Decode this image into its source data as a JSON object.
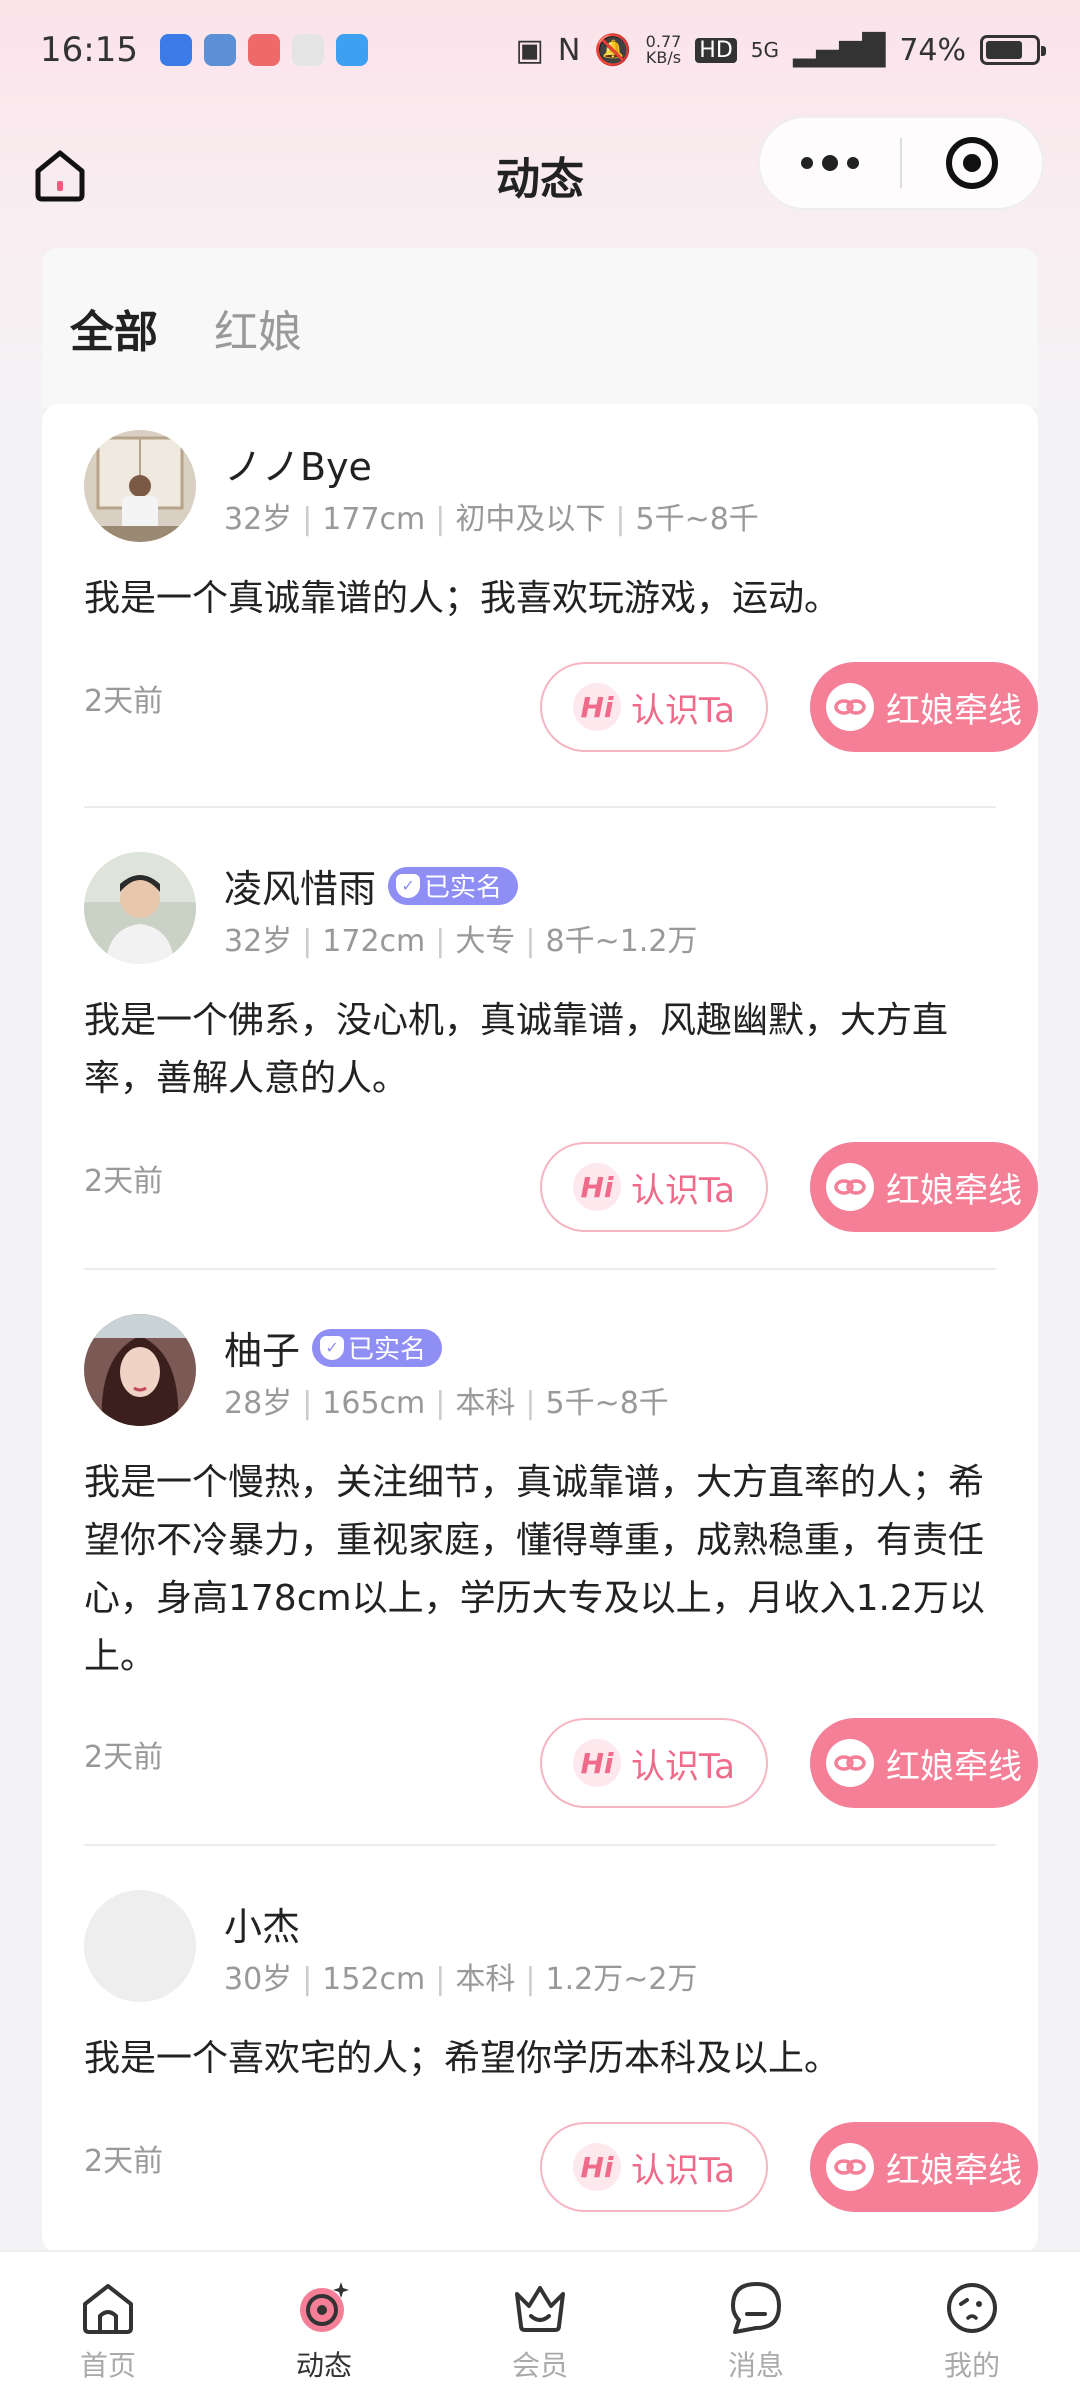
{
  "status_bar": {
    "time": "16:15",
    "net_speed_value": "0.77",
    "net_speed_unit": "KB/s",
    "hd": "HD",
    "network": "5G",
    "battery": "74%"
  },
  "nav": {
    "title": "动态"
  },
  "tabs": [
    {
      "label": "全部",
      "active": true
    },
    {
      "label": "红娘",
      "active": false
    }
  ],
  "posts": [
    {
      "name": "ノノBye",
      "verified": false,
      "age": "32岁",
      "height": "177cm",
      "education": "初中及以下",
      "income": "5千~8千",
      "text": "我是一个真诚靠谱的人；我喜欢玩游戏，运动。",
      "time": "2天前"
    },
    {
      "name": "凌风惜雨",
      "verified": true,
      "verified_label": "已实名",
      "age": "32岁",
      "height": "172cm",
      "education": "大专",
      "income": "8千~1.2万",
      "text": "我是一个佛系，没心机，真诚靠谱，风趣幽默，大方直率，善解人意的人。",
      "time": "2天前"
    },
    {
      "name": "柚子",
      "verified": true,
      "verified_label": "已实名",
      "age": "28岁",
      "height": "165cm",
      "education": "本科",
      "income": "5千~8千",
      "text": "我是一个慢热，关注细节，真诚靠谱，大方直率的人；希望你不冷暴力，重视家庭，懂得尊重，成熟稳重，有责任心，身高178cm以上，学历大专及以上，月收入1.2万以上。",
      "time": "2天前"
    },
    {
      "name": "小杰",
      "verified": false,
      "age": "30岁",
      "height": "152cm",
      "education": "本科",
      "income": "1.2万~2万",
      "text": "我是一个喜欢宅的人；希望你学历本科及以上。",
      "time": "2天前"
    }
  ],
  "buttons": {
    "hi_badge": "Hi",
    "meet": "认识Ta",
    "match": "红娘牵线"
  },
  "tab_bar": [
    {
      "label": "首页",
      "icon": "home-icon"
    },
    {
      "label": "动态",
      "icon": "moments-icon"
    },
    {
      "label": "会员",
      "icon": "crown-icon"
    },
    {
      "label": "消息",
      "icon": "message-icon"
    },
    {
      "label": "我的",
      "icon": "profile-icon"
    }
  ],
  "colors": {
    "accent": "#f47f97",
    "verified": "#8f8ef5",
    "text": "#222222",
    "muted": "#999999"
  }
}
